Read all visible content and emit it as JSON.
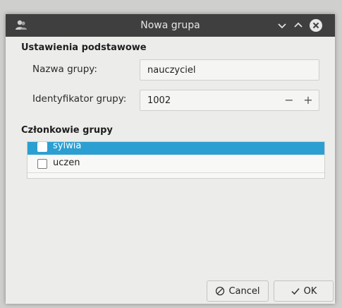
{
  "window": {
    "title": "Nowa grupa"
  },
  "basic_settings": {
    "section_title": "Ustawienia podstawowe",
    "group_name_label": "Nazwa grupy:",
    "group_name_value": "nauczyciel",
    "group_id_label": "Identyfikator grupy:",
    "group_id_value": "1002",
    "decrement_label": "−",
    "increment_label": "+"
  },
  "members": {
    "section_title": "Członkowie grupy",
    "items": [
      {
        "label": "sylwia",
        "checked": false,
        "selected": true
      },
      {
        "label": "uczen",
        "checked": false,
        "selected": false
      }
    ]
  },
  "buttons": {
    "cancel_label": "Cancel",
    "ok_label": "OK"
  },
  "colors": {
    "titlebar": "#3f3f3f",
    "selection": "#2c9fd2",
    "window_bg": "#ececea"
  }
}
